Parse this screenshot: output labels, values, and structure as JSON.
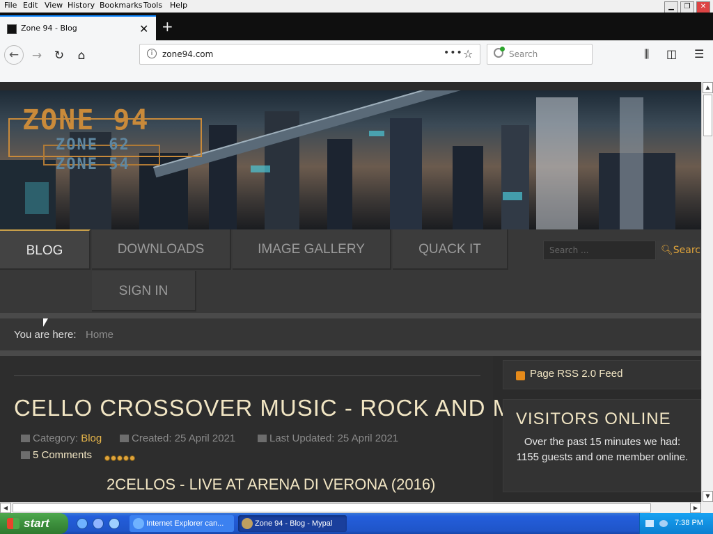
{
  "menubar": {
    "items": [
      "File",
      "Edit",
      "View",
      "History",
      "Bookmarks",
      "Tools",
      "Help"
    ]
  },
  "tab": {
    "title": "Zone 94 - Blog",
    "close": "✕",
    "new": "+"
  },
  "navbar": {
    "url": "zone94.com",
    "search_placeholder": "Search",
    "dots": "•••",
    "star": "☆"
  },
  "site": {
    "logo_main": "ZONE 94",
    "logo_sub1": "ZONE 62",
    "logo_sub2": "ZONE 54",
    "nav": [
      "BLOG",
      "DOWNLOADS",
      "IMAGE GALLERY",
      "QUACK IT",
      "SIGN IN"
    ],
    "search_placeholder": "Search ...",
    "search_button": "Search",
    "breadcrumb_label": "You are here:",
    "breadcrumb_home": "Home"
  },
  "article": {
    "title": "CELLO CROSSOVER MUSIC - ROCK AND METAL",
    "category_label": "Category:",
    "category_value": "Blog",
    "created": "Created: 25 April 2021",
    "updated": "Last Updated: 25 April 2021",
    "comments": "5 Comments",
    "rating": 5,
    "subtitle": "2CELLOS - LIVE AT ARENA DI VERONA (2016)"
  },
  "sidebar": {
    "rss": "Page RSS 2.0 Feed",
    "visitors_title": "VISITORS ONLINE",
    "visitors_text": "Over the past 15 minutes we had: 1155 guests and one member online."
  },
  "taskbar": {
    "start": "start",
    "tasks": [
      "Internet Explorer can...",
      "Zone 94 - Blog - Mypal"
    ],
    "clock": "7:38 PM"
  },
  "colors": {
    "accent": "#e6b54a",
    "heading": "#f2e6c4",
    "taskbar": "#245edb"
  }
}
